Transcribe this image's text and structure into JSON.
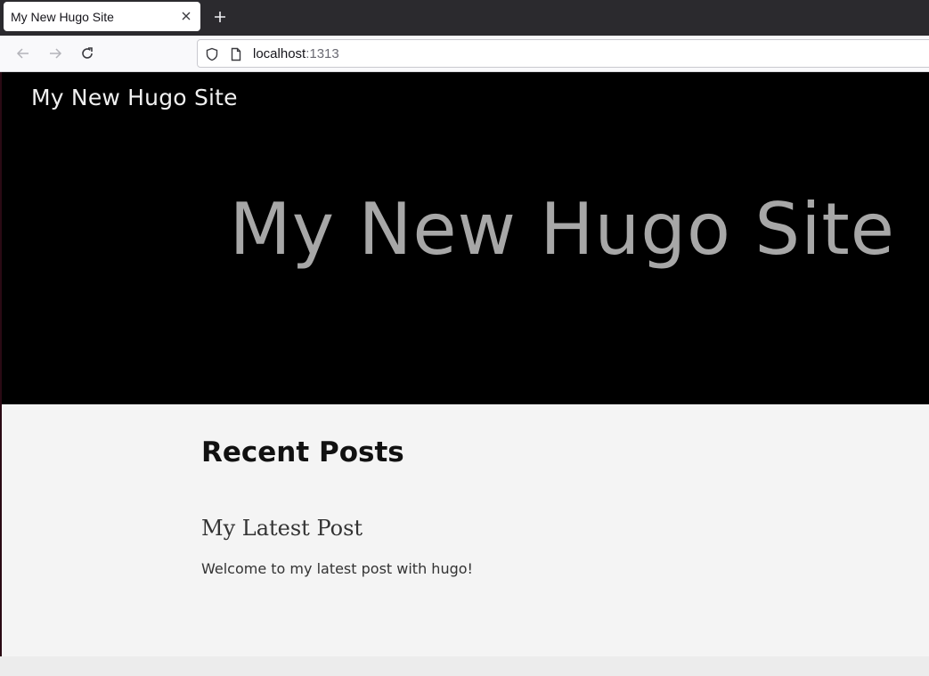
{
  "browser": {
    "tab": {
      "title": "My New Hugo Site"
    },
    "address": {
      "host": "localhost",
      "port": ":1313"
    }
  },
  "page": {
    "site_link": "My New Hugo Site",
    "hero_title": "My New Hugo Site",
    "recent_heading": "Recent Posts",
    "posts": [
      {
        "title": "My Latest Post",
        "summary": "Welcome to my latest post with hugo!"
      }
    ]
  },
  "colors": {
    "tabbar_bg": "#2b2a2e",
    "hero_bg": "#000000",
    "hero_text": "#a7a7a7",
    "page_bg": "#f4f4f4"
  },
  "icons": [
    "close-icon",
    "plus-icon",
    "back-arrow-icon",
    "forward-arrow-icon",
    "reload-icon",
    "shield-icon",
    "page-icon"
  ]
}
